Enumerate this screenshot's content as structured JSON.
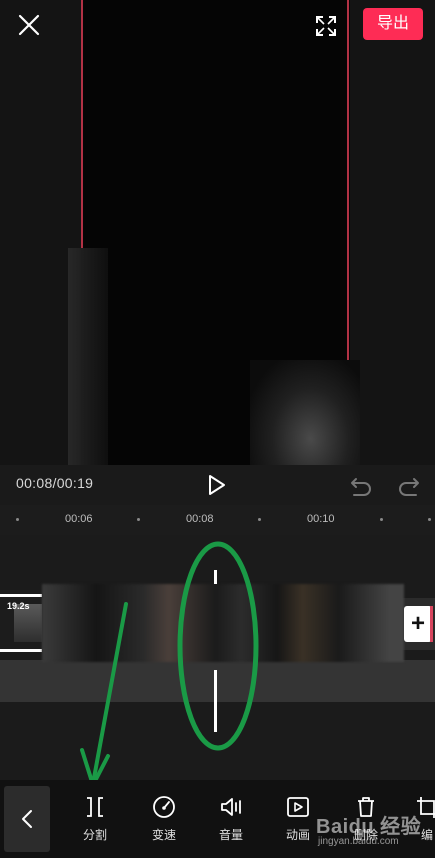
{
  "header": {
    "export_label": "导出"
  },
  "player": {
    "time_display": "00:08/00:19"
  },
  "ruler": {
    "labels": [
      "00:06",
      "00:08",
      "00:10"
    ]
  },
  "track": {
    "duration_badge": "19.2s",
    "add_label": "+"
  },
  "toolbar": {
    "items": [
      {
        "label": "分割",
        "icon": "split-icon"
      },
      {
        "label": "变速",
        "icon": "speed-icon"
      },
      {
        "label": "音量",
        "icon": "volume-icon"
      },
      {
        "label": "动画",
        "icon": "animation-icon"
      },
      {
        "label": "删除",
        "icon": "delete-icon"
      },
      {
        "label": "编",
        "icon": "edit-icon"
      }
    ]
  },
  "watermark": {
    "brand": "Baidu 经验",
    "url": "jingyan.baidu.com"
  },
  "colors": {
    "accent": "#fe2c55",
    "annotation": "#1a9a46"
  }
}
